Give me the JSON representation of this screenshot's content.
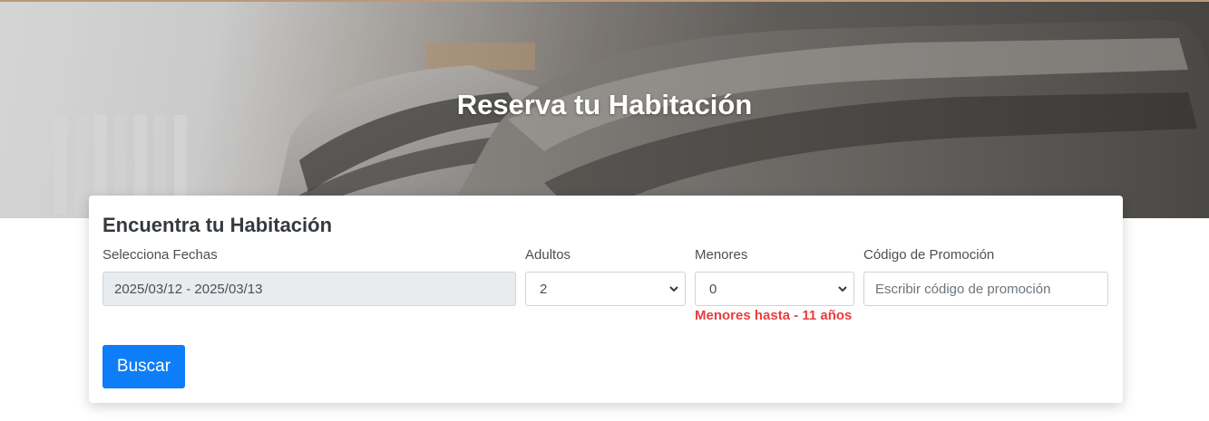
{
  "hero": {
    "title": "Reserva tu Habitación"
  },
  "search_card": {
    "title": "Encuentra tu Habitación",
    "dates": {
      "label": "Selecciona Fechas",
      "value": "2025/03/12 - 2025/03/13"
    },
    "adults": {
      "label": "Adultos",
      "selected": "2"
    },
    "children": {
      "label": "Menores",
      "selected": "0",
      "hint": "Menores hasta - 11 años"
    },
    "promo": {
      "label": "Código de Promoción",
      "value": "",
      "placeholder": "Escribir código de promoción"
    },
    "search_button": "Buscar"
  },
  "colors": {
    "primary": "#0d7ef7",
    "hint_red": "#e83e3e",
    "disabled_field": "#e9ecef"
  },
  "icons": {
    "select_arrow": "chevron-down-icon"
  }
}
